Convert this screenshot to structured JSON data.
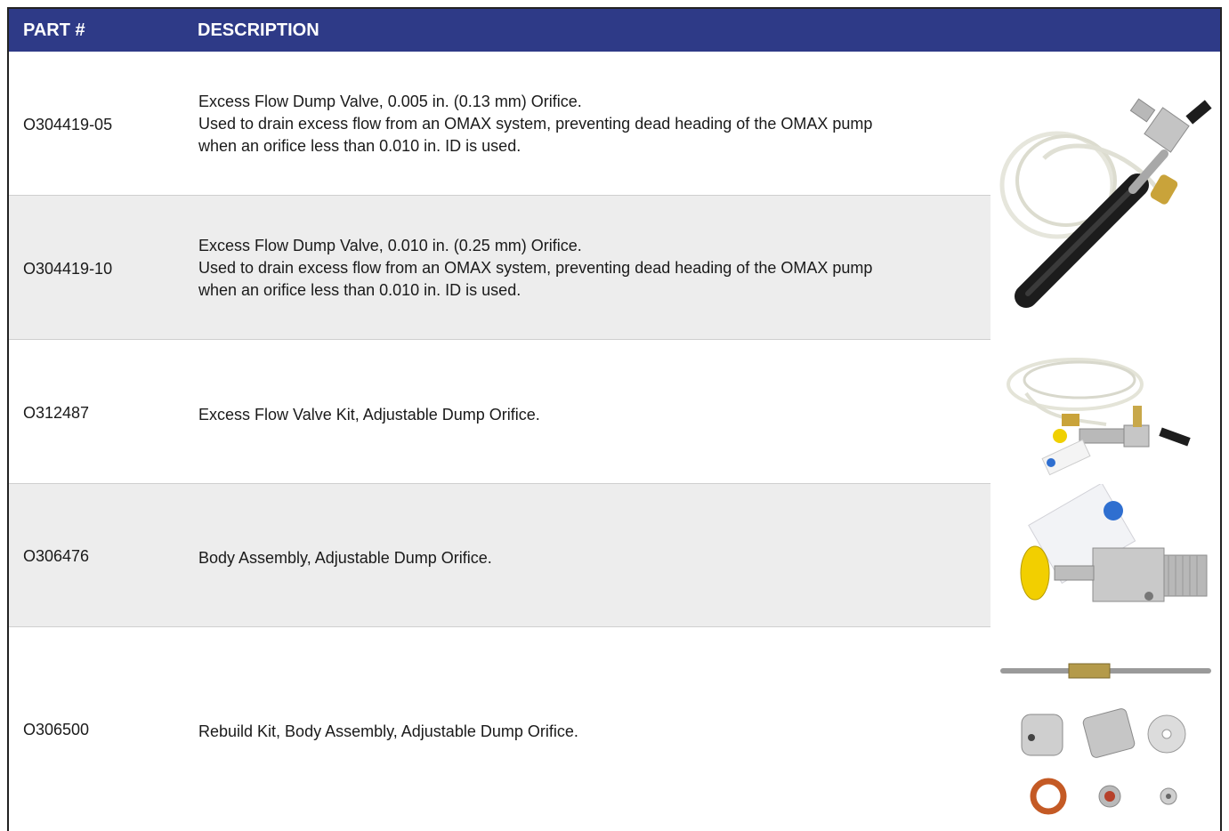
{
  "table": {
    "headers": {
      "part": "PART #",
      "description": "DESCRIPTION"
    },
    "rows": [
      {
        "part": "O304419-05",
        "lines": [
          "Excess Flow Dump Valve, 0.005 in. (0.13 mm) Orifice.",
          "Used to drain excess flow from an OMAX system, preventing dead heading of the OMAX pump",
          "when an orifice less than 0.010 in. ID is used."
        ]
      },
      {
        "part": "O304419-10",
        "lines": [
          "Excess Flow Dump Valve, 0.010 in. (0.25 mm) Orifice.",
          "Used to drain excess flow from an OMAX system, preventing dead heading of the OMAX pump",
          "when an orifice less than 0.010 in. ID is used."
        ]
      },
      {
        "part": "O312487",
        "lines": [
          "Excess Flow Valve Kit, Adjustable Dump Orifice."
        ]
      },
      {
        "part": "O306476",
        "lines": [
          "Body Assembly, Adjustable Dump Orifice."
        ]
      },
      {
        "part": "O306500",
        "lines": [
          "Rebuild Kit, Body Assembly, Adjustable Dump Orifice."
        ]
      }
    ]
  },
  "colors": {
    "header_bg": "#2e3a87",
    "shaded_row": "#ededed"
  },
  "images": [
    "dump-valve-photo",
    "valve-kit-photo",
    "body-assembly-photo",
    "rebuild-kit-photo"
  ]
}
